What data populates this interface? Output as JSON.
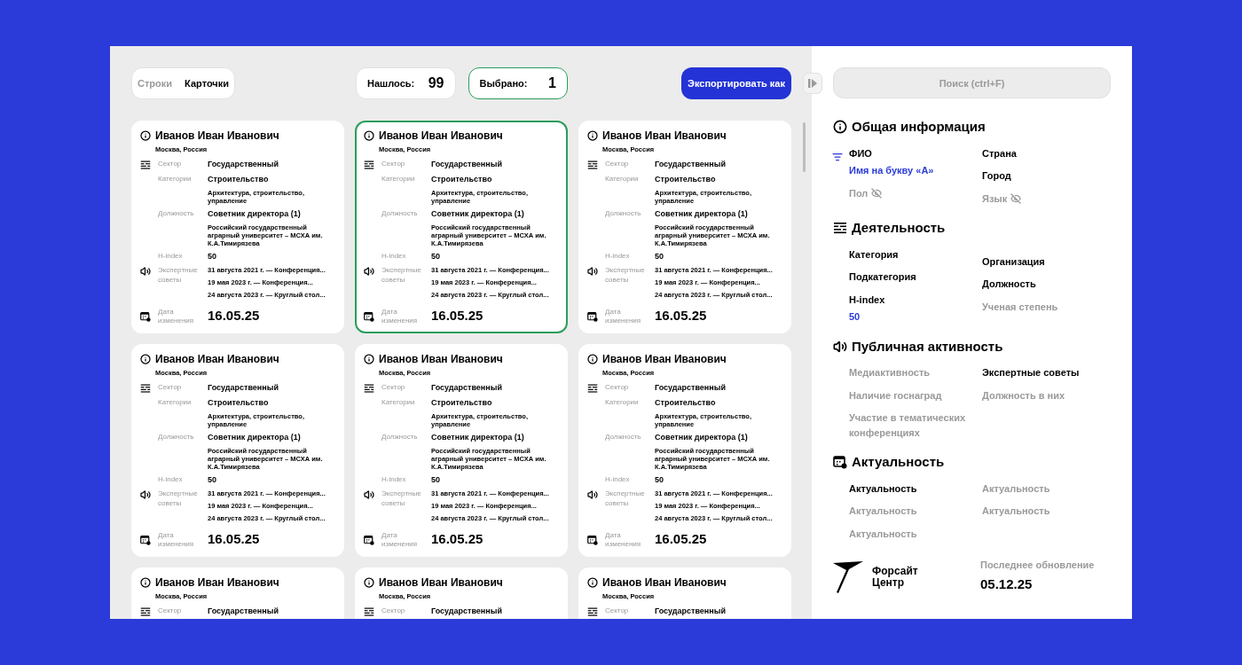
{
  "view_toggle": [
    {
      "label": "Строки",
      "selected": false
    },
    {
      "label": "Карточки",
      "selected": true
    }
  ],
  "counters": [
    {
      "label": "Нашлось:",
      "value": "99",
      "highlighted": false
    },
    {
      "label": "Выбрано:",
      "value": "1",
      "highlighted": true
    }
  ],
  "export_button": "Экспортировать как",
  "cards": [
    {
      "name": "Иванов Иван Иванович",
      "location": "Москва, Россия",
      "selected": false,
      "sector": {
        "label": "Сектор",
        "value": "Государственный"
      },
      "category": {
        "label": "Категории",
        "value": "Строительство",
        "detail": "Архитектура, строительство, управление"
      },
      "position": {
        "label": "Должность",
        "value": "Советник директора (1)",
        "detail": "Российский государственный аграрный университет – МСХА им. К.А.Тимирязева"
      },
      "hindex": {
        "label": "H-index",
        "value": "50"
      },
      "councils": {
        "label": "Экспертные советы",
        "items": [
          "31 августа 2021 г. — Конференция...",
          "19 мая 2023 г. — Конференция...",
          "24 августа 2023 г. — Круглый стол..."
        ]
      },
      "date": {
        "label": "Дата изменения",
        "value": "16.05.25"
      }
    },
    {
      "name": "Иванов Иван Иванович",
      "location": "Москва, Россия",
      "selected": true,
      "sector": {
        "label": "Сектор",
        "value": "Государственный"
      },
      "category": {
        "label": "Категории",
        "value": "Строительство",
        "detail": "Архитектура, строительство, управление"
      },
      "position": {
        "label": "Должность",
        "value": "Советник директора (1)",
        "detail": "Российский государственный аграрный университет – МСХА им. К.А.Тимирязева"
      },
      "hindex": {
        "label": "H-index",
        "value": "50"
      },
      "councils": {
        "label": "Экспертные советы",
        "items": [
          "31 августа 2021 г. — Конференция...",
          "19 мая 2023 г. — Конференция...",
          "24 августа 2023 г. — Круглый стол..."
        ]
      },
      "date": {
        "label": "Дата изменения",
        "value": "16.05.25"
      }
    },
    {
      "name": "Иванов Иван Иванович",
      "location": "Москва, Россия",
      "selected": false,
      "sector": {
        "label": "Сектор",
        "value": "Государственный"
      },
      "category": {
        "label": "Категории",
        "value": "Строительство",
        "detail": "Архитектура, строительство, управление"
      },
      "position": {
        "label": "Должность",
        "value": "Советник директора (1)",
        "detail": "Российский государственный аграрный университет – МСХА им. К.А.Тимирязева"
      },
      "hindex": {
        "label": "H-index",
        "value": "50"
      },
      "councils": {
        "label": "Экспертные советы",
        "items": [
          "31 августа 2021 г. — Конференция...",
          "19 мая 2023 г. — Конференция...",
          "24 августа 2023 г. — Круглый стол..."
        ]
      },
      "date": {
        "label": "Дата изменения",
        "value": "16.05.25"
      }
    },
    {
      "name": "Иванов Иван Иванович",
      "location": "Москва, Россия",
      "selected": false,
      "sector": {
        "label": "Сектор",
        "value": "Государственный"
      },
      "category": {
        "label": "Категории",
        "value": "Строительство",
        "detail": "Архитектура, строительство, управление"
      },
      "position": {
        "label": "Должность",
        "value": "Советник директора (1)",
        "detail": "Российский государственный аграрный университет – МСХА им. К.А.Тимирязева"
      },
      "hindex": {
        "label": "H-index",
        "value": "50"
      },
      "councils": {
        "label": "Экспертные советы",
        "items": [
          "31 августа 2021 г. — Конференция...",
          "19 мая 2023 г. — Конференция...",
          "24 августа 2023 г. — Круглый стол..."
        ]
      },
      "date": {
        "label": "Дата изменения",
        "value": "16.05.25"
      }
    },
    {
      "name": "Иванов Иван Иванович",
      "location": "Москва, Россия",
      "selected": false,
      "sector": {
        "label": "Сектор",
        "value": "Государственный"
      },
      "category": {
        "label": "Категории",
        "value": "Строительство",
        "detail": "Архитектура, строительство, управление"
      },
      "position": {
        "label": "Должность",
        "value": "Советник директора (1)",
        "detail": "Российский государственный аграрный университет – МСХА им. К.А.Тимирязева"
      },
      "hindex": {
        "label": "H-index",
        "value": "50"
      },
      "councils": {
        "label": "Экспертные советы",
        "items": [
          "31 августа 2021 г. — Конференция...",
          "19 мая 2023 г. — Конференция...",
          "24 августа 2023 г. — Круглый стол..."
        ]
      },
      "date": {
        "label": "Дата изменения",
        "value": "16.05.25"
      }
    },
    {
      "name": "Иванов Иван Иванович",
      "location": "Москва, Россия",
      "selected": false,
      "sector": {
        "label": "Сектор",
        "value": "Государственный"
      },
      "category": {
        "label": "Категории",
        "value": "Строительство",
        "detail": "Архитектура, строительство, управление"
      },
      "position": {
        "label": "Должность",
        "value": "Советник директора (1)",
        "detail": "Российский государственный аграрный университет – МСХА им. К.А.Тимирязева"
      },
      "hindex": {
        "label": "H-index",
        "value": "50"
      },
      "councils": {
        "label": "Экспертные советы",
        "items": [
          "31 августа 2021 г. — Конференция...",
          "19 мая 2023 г. — Конференция...",
          "24 августа 2023 г. — Круглый стол..."
        ]
      },
      "date": {
        "label": "Дата изменения",
        "value": "16.05.25"
      }
    },
    {
      "name": "Иванов Иван Иванович",
      "location": "Москва, Россия",
      "selected": false,
      "sector": {
        "label": "Сектор",
        "value": "Государственный"
      }
    },
    {
      "name": "Иванов Иван Иванович",
      "location": "Москва, Россия",
      "selected": false,
      "sector": {
        "label": "Сектор",
        "value": "Государственный"
      }
    },
    {
      "name": "Иванов Иван Иванович",
      "location": "Москва, Россия",
      "selected": false,
      "sector": {
        "label": "Сектор",
        "value": "Государственный"
      }
    }
  ],
  "search": {
    "placeholder": "Поиск (ctrl+F)"
  },
  "sections": [
    {
      "kind": "info",
      "title": "Общая информация",
      "left": [
        {
          "label": "ФИО",
          "active": true,
          "hidden": false,
          "filter": "Имя на букву «А»"
        },
        {
          "label": "Пол",
          "active": false,
          "hidden": true
        }
      ],
      "right": [
        {
          "label": "Страна",
          "active": true,
          "hidden": false
        },
        {
          "label": "Город",
          "active": true,
          "hidden": false
        },
        {
          "label": "Язык",
          "active": false,
          "hidden": true
        }
      ]
    },
    {
      "kind": "activity",
      "title": "Деятельность",
      "left": [
        {
          "label": "Категория",
          "active": true,
          "hidden": false
        },
        {
          "label": "Подкатегория",
          "active": true,
          "hidden": false
        },
        {
          "label": "H-index",
          "active": true,
          "hidden": false,
          "value": "50"
        }
      ],
      "right": [
        {
          "label": "Организация",
          "active": true,
          "hidden": false
        },
        {
          "label": "Должность",
          "active": true,
          "hidden": false
        },
        {
          "label": "Ученая степень",
          "active": false,
          "hidden": false
        }
      ]
    },
    {
      "kind": "public",
      "title": "Публичная активность",
      "left": [
        {
          "label": "Медиактивность",
          "active": false,
          "hidden": false
        },
        {
          "label": "Наличие госнаград",
          "active": false,
          "hidden": false
        },
        {
          "label": "Участие в тематических конференциях",
          "active": false,
          "hidden": false
        }
      ],
      "right": [
        {
          "label": "Экспертные советы",
          "active": true,
          "hidden": false
        },
        {
          "label": "Должность в них",
          "active": false,
          "hidden": false
        }
      ]
    },
    {
      "kind": "relevance",
      "title": "Актуальность",
      "left": [
        {
          "label": "Актуальность",
          "active": true,
          "hidden": false
        },
        {
          "label": "Актуальность",
          "active": false,
          "hidden": false
        },
        {
          "label": "Актуальность",
          "active": false,
          "hidden": false
        }
      ],
      "right": [
        {
          "label": "Актуальность",
          "active": false,
          "hidden": false
        },
        {
          "label": "Актуальность",
          "active": false,
          "hidden": false
        }
      ]
    }
  ],
  "footer": {
    "logo_text": "Форсайт Центр",
    "update_label": "Последнее обновление",
    "update_date": "05.12.25"
  }
}
